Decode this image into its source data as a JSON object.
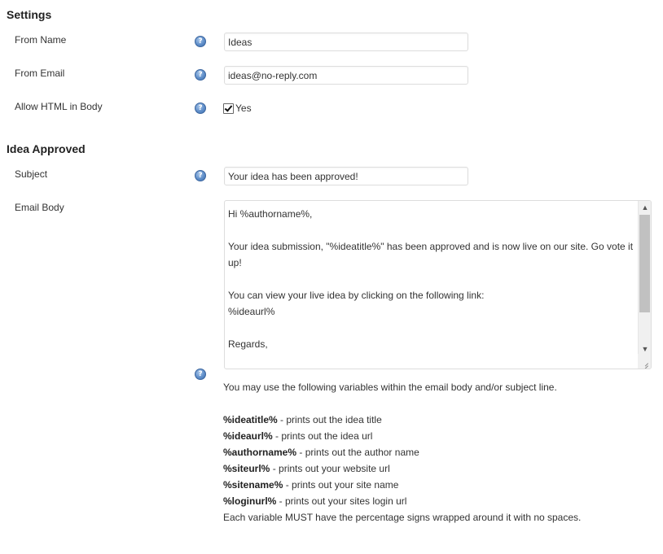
{
  "settings": {
    "title": "Settings",
    "from_name": {
      "label": "From Name",
      "value": "Ideas"
    },
    "from_email": {
      "label": "From Email",
      "value": "ideas@no-reply.com"
    },
    "allow_html": {
      "label": "Allow HTML in Body",
      "checkbox_label": "Yes",
      "checked": true
    }
  },
  "idea_approved": {
    "title": "Idea Approved",
    "subject": {
      "label": "Subject",
      "value": "Your idea has been approved!"
    },
    "email_body": {
      "label": "Email Body",
      "value": "Hi %authorname%,\n\nYour idea submission, \"%ideatitle%\" has been approved and is now live on our site. Go vote it up!\n\nYou can view your live idea by clicking on the following link:\n%ideaurl%\n\nRegards,"
    }
  },
  "help": {
    "intro": "You may use the following variables within the email body and/or subject line.",
    "variables": [
      {
        "name": "%ideatitle%",
        "desc": " - prints out the idea title"
      },
      {
        "name": "%ideaurl%",
        "desc": " - prints out the idea url"
      },
      {
        "name": "%authorname%",
        "desc": " - prints out the author name"
      },
      {
        "name": "%siteurl%",
        "desc": " - prints out your website url"
      },
      {
        "name": "%sitename%",
        "desc": " - prints out your site name"
      },
      {
        "name": "%loginurl%",
        "desc": " - prints out your sites login url"
      }
    ],
    "note": "Each variable MUST have the percentage signs wrapped around it with no spaces."
  },
  "icons": {
    "help": "help-circle-icon",
    "scroll_up": "chevron-up-icon",
    "scroll_down": "chevron-down-icon",
    "resize": "resize-grip-icon"
  },
  "colors": {
    "help_icon": "#5f8ec9",
    "input_border": "#dddddd",
    "text": "#333333"
  }
}
